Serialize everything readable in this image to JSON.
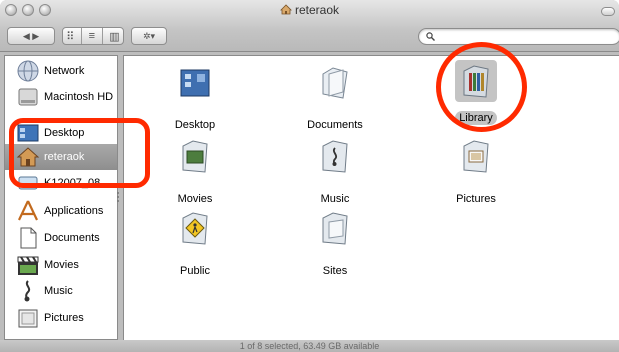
{
  "window": {
    "title": "reteraok",
    "status": "1 of 8 selected, 63.49 GB available"
  },
  "toolbar": {
    "back_forward": "◀ ▶",
    "view_icons": "⠿",
    "view_list": "≡",
    "view_columns": "▥",
    "action": "✲▾",
    "search_placeholder": ""
  },
  "sidebar": {
    "items": [
      {
        "label": "Network",
        "icon": "network-globe-icon"
      },
      {
        "label": "Macintosh HD",
        "icon": "hard-drive-icon"
      },
      {
        "label": "Desktop",
        "icon": "desktop-icon"
      },
      {
        "label": "reteraok",
        "icon": "home-house-icon",
        "selected": true
      },
      {
        "label": "K12007_08",
        "icon": "drive-icon"
      },
      {
        "label": "Applications",
        "icon": "applications-icon"
      },
      {
        "label": "Documents",
        "icon": "documents-icon"
      },
      {
        "label": "Movies",
        "icon": "movies-clapper-icon"
      },
      {
        "label": "Music",
        "icon": "music-note-icon"
      },
      {
        "label": "Pictures",
        "icon": "pictures-frame-icon"
      }
    ]
  },
  "main": {
    "items": [
      {
        "label": "Desktop",
        "icon": "desktop-folder-icon"
      },
      {
        "label": "Documents",
        "icon": "documents-folder-icon"
      },
      {
        "label": "Library",
        "icon": "library-folder-icon",
        "selected": true
      },
      {
        "label": "Movies",
        "icon": "movies-folder-icon"
      },
      {
        "label": "Music",
        "icon": "music-folder-icon"
      },
      {
        "label": "Pictures",
        "icon": "pictures-folder-icon"
      },
      {
        "label": "Public",
        "icon": "public-folder-icon"
      },
      {
        "label": "Sites",
        "icon": "sites-folder-icon"
      }
    ]
  },
  "colors": {
    "annotation": "#ff2a00",
    "selection": "#c4c4c4",
    "sidebar_selected": "#8e8e8e"
  }
}
